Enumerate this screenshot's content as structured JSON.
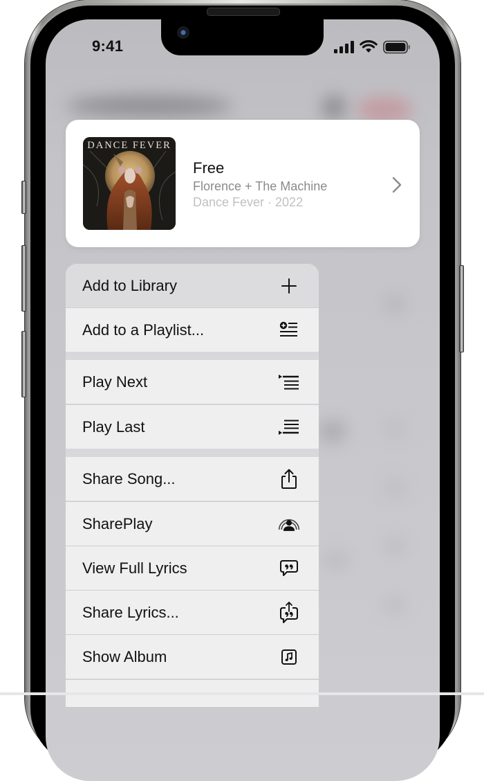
{
  "status_bar": {
    "time": "9:41",
    "icons": [
      "cellular-signal-icon",
      "wifi-icon",
      "battery-icon"
    ]
  },
  "song_card": {
    "album_art_text": "DANCE FEVER",
    "title": "Free",
    "artist": "Florence + The Machine",
    "meta": "Dance Fever · 2022",
    "chevron_icon": "chevron-right-icon"
  },
  "menu": {
    "groups": [
      [
        {
          "label": "Add to Library",
          "icon": "plus-icon"
        },
        {
          "label": "Add to a Playlist...",
          "icon": "add-to-playlist-icon"
        }
      ],
      [
        {
          "label": "Play Next",
          "icon": "play-next-icon"
        },
        {
          "label": "Play Last",
          "icon": "play-last-icon"
        }
      ],
      [
        {
          "label": "Share Song...",
          "icon": "share-icon"
        },
        {
          "label": "SharePlay",
          "icon": "shareplay-icon"
        },
        {
          "label": "View Full Lyrics",
          "icon": "lyrics-icon"
        },
        {
          "label": "Share Lyrics...",
          "icon": "share-lyrics-icon"
        },
        {
          "label": "Show Album",
          "icon": "album-icon"
        }
      ]
    ]
  },
  "colors": {
    "menu_row_bg": "#efeff0",
    "menu_highlight_bg": "#dcdcde",
    "secondary_text": "#8a8a8e",
    "tertiary_text": "#c0c0c4"
  }
}
